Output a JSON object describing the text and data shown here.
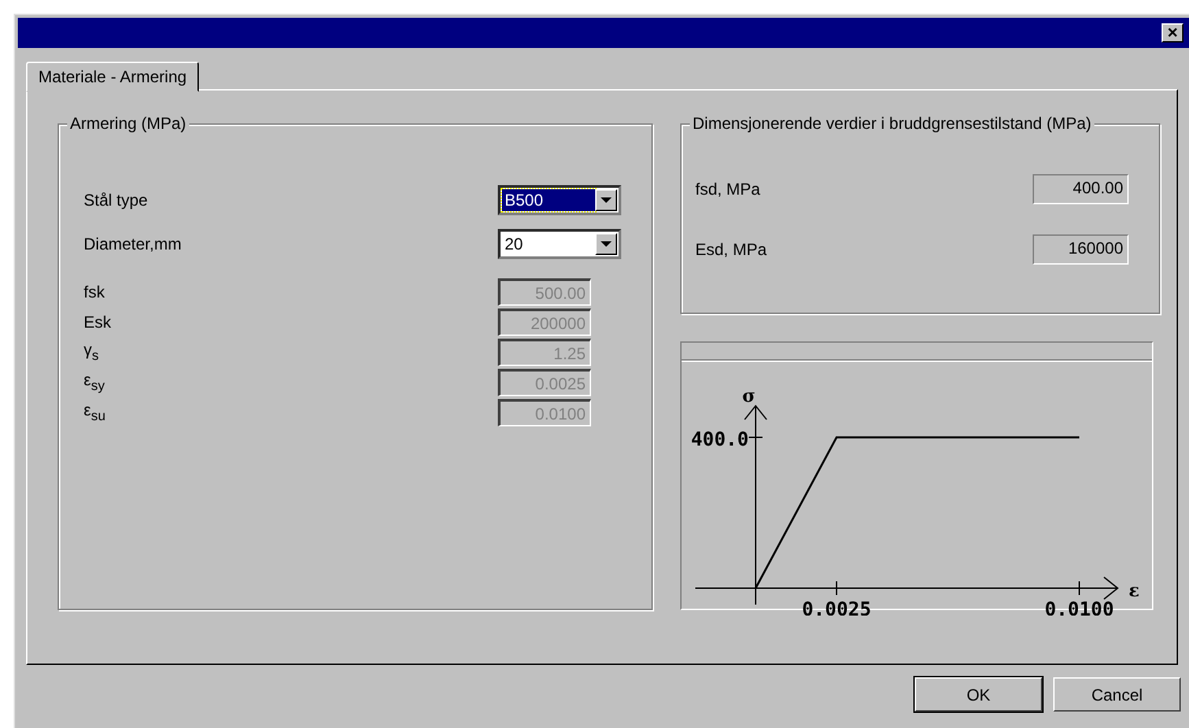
{
  "window": {
    "close": "×"
  },
  "tabs": [
    {
      "label": "Materiale - Armering",
      "selected": true
    }
  ],
  "armering": {
    "title": "Armering (MPa)",
    "selects": [
      {
        "label": "Stål type",
        "value": "B500",
        "focused": true
      },
      {
        "label": "Diameter,mm",
        "value": "20",
        "focused": false
      }
    ],
    "fields": [
      {
        "label": "fsk",
        "value": "500.00",
        "disabled": true
      },
      {
        "label": "Esk",
        "value": "200000",
        "disabled": true
      },
      {
        "label": "γ$_{s}$",
        "value": "1.25",
        "disabled": true
      },
      {
        "label": "ε$_{sy}$",
        "value": "0.0025",
        "disabled": true
      },
      {
        "label": "ε$_{su}$",
        "value": "0.0100",
        "disabled": true
      }
    ]
  },
  "design": {
    "title": "Dimensjonerende verdier i bruddgrensestilstand (MPa)",
    "fields": [
      {
        "label": "fsd, MPa",
        "value": "400.00"
      },
      {
        "label": "Esd, MPa",
        "value": "160000"
      }
    ]
  },
  "diagram": {
    "y_axis_label": "σ",
    "x_axis_label": "ε",
    "y_mark_label": "400.0",
    "x_mark_labels": [
      "0.0025",
      "0.0100"
    ]
  },
  "buttons": [
    {
      "label": "OK",
      "default": true
    },
    {
      "label": "Cancel",
      "default": false
    }
  ]
}
